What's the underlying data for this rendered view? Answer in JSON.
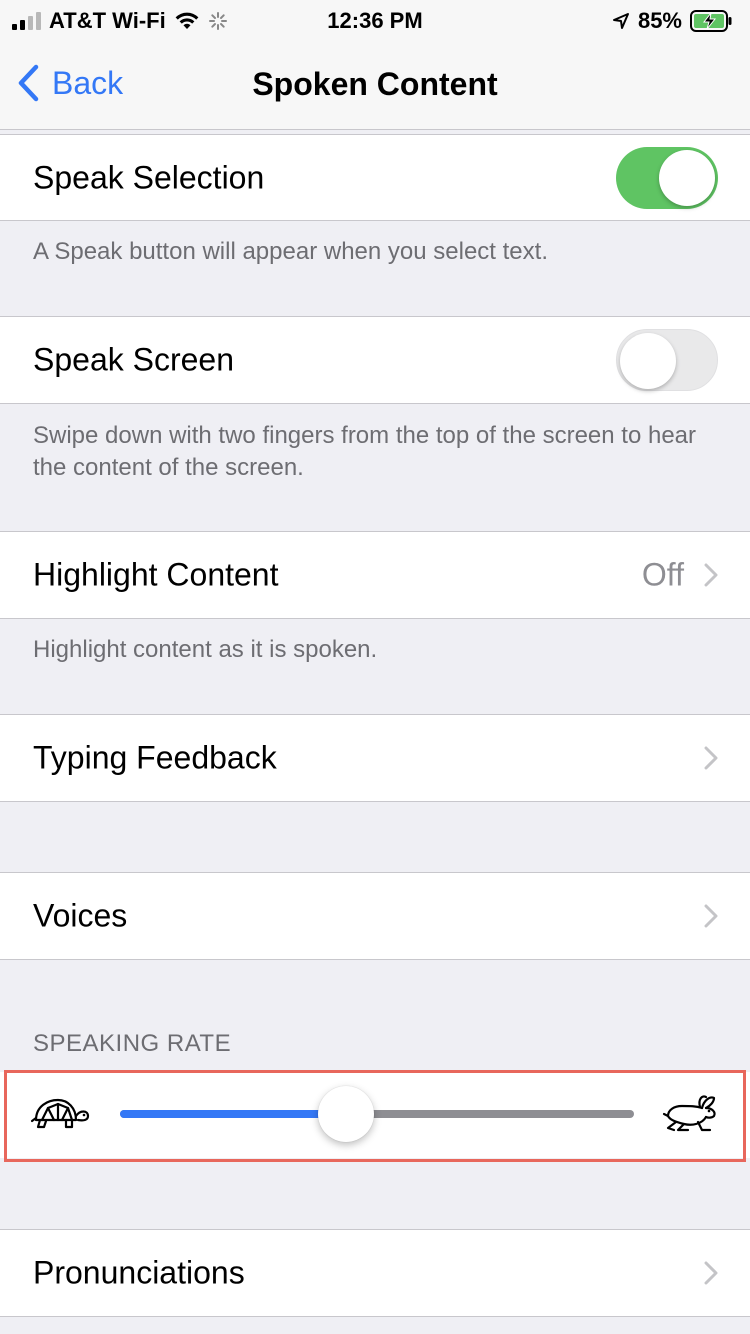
{
  "status_bar": {
    "carrier": "AT&T Wi-Fi",
    "time": "12:36 PM",
    "battery": "85%"
  },
  "nav": {
    "back_label": "Back",
    "title": "Spoken Content"
  },
  "speak_selection": {
    "label": "Speak Selection",
    "enabled": true,
    "footer": "A Speak button will appear when you select text."
  },
  "speak_screen": {
    "label": "Speak Screen",
    "enabled": false,
    "footer": "Swipe down with two fingers from the top of the screen to hear the content of the screen."
  },
  "highlight_content": {
    "label": "Highlight Content",
    "value": "Off",
    "footer": "Highlight content as it is spoken."
  },
  "typing_feedback": {
    "label": "Typing Feedback"
  },
  "voices": {
    "label": "Voices"
  },
  "speaking_rate": {
    "header": "SPEAKING RATE",
    "value_fraction": 0.44
  },
  "pronunciations": {
    "label": "Pronunciations"
  },
  "colors": {
    "accent": "#3478f6",
    "toggle_on": "#5fc463",
    "highlight_box": "#e8675c"
  }
}
